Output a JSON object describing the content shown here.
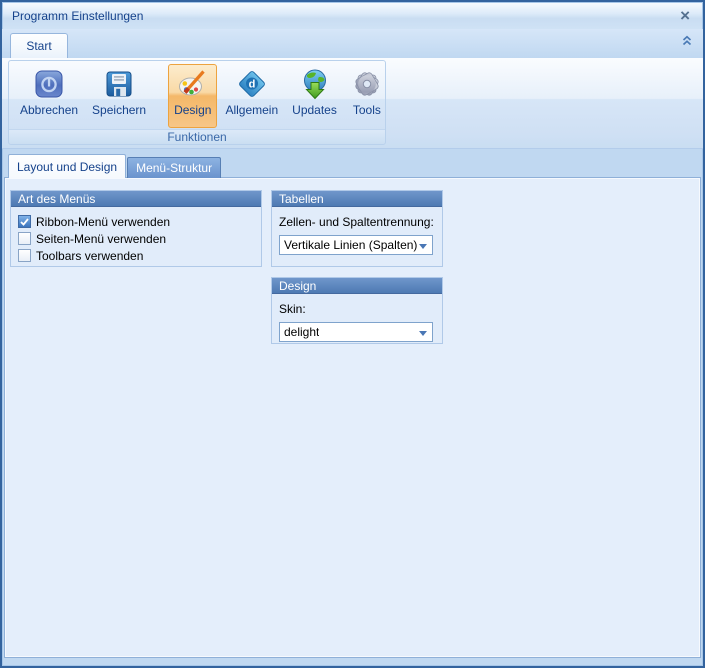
{
  "window": {
    "title": "Programm Einstellungen",
    "close_glyph": "×"
  },
  "ribbon": {
    "tab_label": "Start",
    "group_label": "Funktionen",
    "buttons": [
      {
        "label": "Abbrechen",
        "icon": "power-icon",
        "selected": false
      },
      {
        "label": "Speichern",
        "icon": "save-icon",
        "selected": false
      },
      {
        "label": "Design",
        "icon": "palette-icon",
        "selected": true
      },
      {
        "label": "Allgemein",
        "icon": "diamond-d-icon",
        "selected": false
      },
      {
        "label": "Updates",
        "icon": "globe-download-icon",
        "selected": false
      },
      {
        "label": "Tools",
        "icon": "gear-icon",
        "selected": false
      }
    ]
  },
  "page_tabs": [
    {
      "label": "Layout und Design",
      "active": true
    },
    {
      "label": "Menü-Struktur",
      "active": false
    }
  ],
  "panels": {
    "menu_type": {
      "title": "Art des Menüs",
      "options": [
        {
          "label": "Ribbon-Menü verwenden",
          "checked": true
        },
        {
          "label": "Seiten-Menü verwenden",
          "checked": false
        },
        {
          "label": "Toolbars verwenden",
          "checked": false
        }
      ]
    },
    "tables": {
      "title": "Tabellen",
      "field_label": "Zellen- und Spaltentrennung:",
      "dropdown_value": "Vertikale Linien (Spalten)"
    },
    "design": {
      "title": "Design",
      "field_label": "Skin:",
      "dropdown_value": "delight"
    }
  },
  "colors": {
    "selected_button_accent": "#F5A94F",
    "panel_header": "#4E7AB3",
    "title_text": "#15428B",
    "page_background": "#E4EEFB",
    "window_border": "#33639E"
  }
}
